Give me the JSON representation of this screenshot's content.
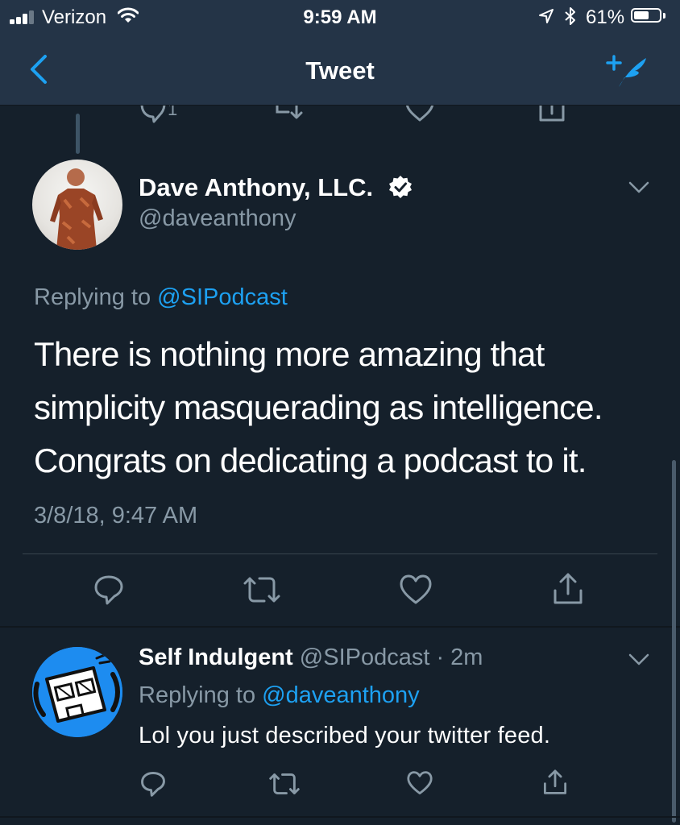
{
  "status_bar": {
    "carrier": "Verizon",
    "time": "9:59 AM",
    "battery_percent": "61%",
    "battery_level": 0.61,
    "icons": [
      "signal-icon",
      "wifi-icon",
      "location-icon",
      "bluetooth-icon",
      "battery-icon"
    ]
  },
  "nav": {
    "title": "Tweet",
    "back_icon": "chevron-left-icon",
    "compose_icon": "compose-tweet-icon"
  },
  "previous_tweet": {
    "reply_count": "1"
  },
  "main_tweet": {
    "display_name": "Dave Anthony, LLC.",
    "handle": "@daveanthony",
    "replying_label": "Replying to",
    "replying_to": "@SIPodcast",
    "text_lines": [
      "There is nothing more amazing that",
      "simplicity masquerading as intelligence.",
      "Congrats on dedicating a podcast to it."
    ],
    "timestamp": "3/8/18, 9:47 AM"
  },
  "reply_tweet": {
    "display_name": "Self Indulgent",
    "handle": "@SIPodcast",
    "time_ago": "· 2m",
    "replying_label": "Replying to",
    "replying_to": "@daveanthony",
    "text": "Lol you just described your twitter feed."
  },
  "colors": {
    "background": "#15202b",
    "bar": "#243447",
    "accent": "#1da1f2",
    "secondary_text": "#8899a6",
    "divider": "#38444d"
  }
}
